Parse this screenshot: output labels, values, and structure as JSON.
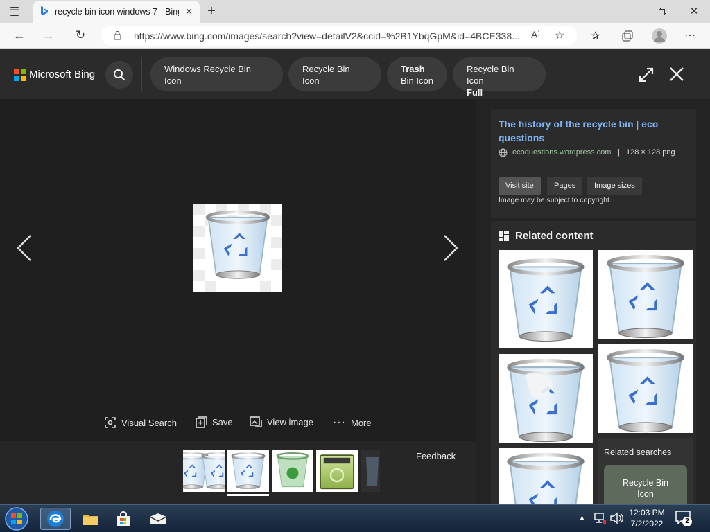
{
  "browser": {
    "tab_title": "recycle bin icon windows 7 - Bing",
    "url": "https://www.bing.com/images/search?view=detailV2&ccid=%2B1YbqGpM&id=4BCE338..."
  },
  "header": {
    "logo_text": "Microsoft Bing",
    "chips": [
      {
        "line1": "Windows Recycle Bin Icon",
        "line2": ""
      },
      {
        "line1": "Recycle Bin Icon",
        "line2": ""
      },
      {
        "line1": "Trash",
        "line2": "Bin Icon"
      },
      {
        "line1": "Recycle Bin Icon",
        "line2": "Full"
      }
    ]
  },
  "viewer": {
    "actions": {
      "visual_search": "Visual Search",
      "save": "Save",
      "view_image": "View image",
      "more": "More"
    },
    "feedback": "Feedback"
  },
  "source": {
    "title": "The history of the recycle bin | eco questions",
    "domain": "ecoquestions.wordpress.com",
    "meta": "128 × 128 png",
    "buttons": {
      "visit": "Visit site",
      "pages": "Pages",
      "sizes": "Image sizes"
    },
    "copyright": "Image may be subject to copyright."
  },
  "related": {
    "heading": "Related content",
    "searches_heading": "Related searches",
    "search_item": "Recycle Bin Icon"
  },
  "taskbar": {
    "time": "12:03 PM",
    "date": "7/2/2022",
    "notification_count": "2"
  },
  "colors": {
    "accent_link": "#7fb3f5",
    "domain_green": "#9ec59e",
    "bing_dark": "#202020"
  }
}
